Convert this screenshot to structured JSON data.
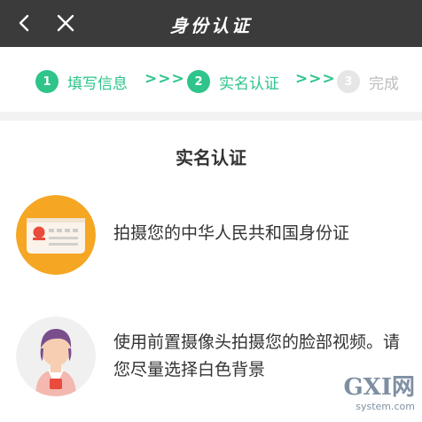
{
  "nav": {
    "title": "身份认证",
    "back_icon": "chevron-left-icon",
    "close_icon": "close-icon"
  },
  "steps": [
    {
      "number": "1",
      "label": "填写信息",
      "state": "done"
    },
    {
      "number": "2",
      "label": "实名认证",
      "state": "current"
    },
    {
      "number": "3",
      "label": "完成",
      "state": "pending"
    }
  ],
  "step_separator": ">>>",
  "section": {
    "title": "实名认证"
  },
  "items": [
    {
      "icon": "id-card-icon",
      "text": "拍摄您的中华人民共和国身份证"
    },
    {
      "icon": "person-avatar-icon",
      "text": "使用前置摄像头拍摄您的脸部视频。请您尽量选择白色背景"
    }
  ],
  "watermark": {
    "logo": "GXI网",
    "domain": "system.com"
  },
  "colors": {
    "accent": "#2ec48a",
    "navbar": "#3b3b3b",
    "id_card_bg": "#f5a623",
    "avatar_bg": "#f0f0f0"
  }
}
